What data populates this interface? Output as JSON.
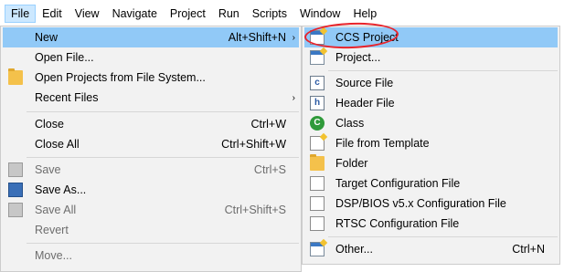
{
  "menubar": {
    "items": [
      "File",
      "Edit",
      "View",
      "Navigate",
      "Project",
      "Run",
      "Scripts",
      "Window",
      "Help"
    ]
  },
  "file_menu": {
    "items": [
      {
        "label": "New",
        "shortcut": "Alt+Shift+N",
        "submenu_arrow": "›"
      },
      {
        "label": "Open File..."
      },
      {
        "label": "Open Projects from File System..."
      },
      {
        "label": "Recent Files",
        "submenu_arrow": "›"
      },
      {
        "label": "Close",
        "shortcut": "Ctrl+W"
      },
      {
        "label": "Close All",
        "shortcut": "Ctrl+Shift+W"
      },
      {
        "label": "Save",
        "shortcut": "Ctrl+S"
      },
      {
        "label": "Save As..."
      },
      {
        "label": "Save All",
        "shortcut": "Ctrl+Shift+S"
      },
      {
        "label": "Revert"
      },
      {
        "label": "Move..."
      }
    ]
  },
  "new_submenu": {
    "items": [
      {
        "label": "CCS Project",
        "icon": "ccs-project-icon"
      },
      {
        "label": "Project...",
        "icon": "project-icon"
      },
      {
        "label": "Source File",
        "icon": "source-file-icon"
      },
      {
        "label": "Header File",
        "icon": "header-file-icon"
      },
      {
        "label": "Class",
        "icon": "class-icon"
      },
      {
        "label": "File from Template",
        "icon": "file-template-icon"
      },
      {
        "label": "Folder",
        "icon": "folder-icon"
      },
      {
        "label": "Target Configuration File",
        "icon": "target-config-icon"
      },
      {
        "label": "DSP/BIOS v5.x Configuration File",
        "icon": "dsp-bios-config-icon"
      },
      {
        "label": "RTSC Configuration File",
        "icon": "rtsc-config-icon"
      },
      {
        "label": "Other...",
        "shortcut": "Ctrl+N",
        "icon": "other-wizard-icon"
      }
    ]
  },
  "colors": {
    "menu_bg": "#f2f2f2",
    "highlight": "#91c9f7",
    "annotation_circle": "#e8232a"
  }
}
